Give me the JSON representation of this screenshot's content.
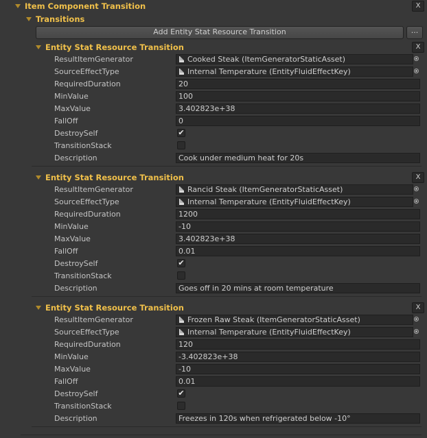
{
  "component": {
    "title": "Item Component Transition",
    "close_label": "X"
  },
  "transitions": {
    "title": "Transitions",
    "add_label": "Add Entity Stat Resource Transition",
    "more_label": "..."
  },
  "labels": {
    "result": "ResultItemGenerator",
    "source": "SourceEffectType",
    "duration": "RequiredDuration",
    "min": "MinValue",
    "max": "MaxValue",
    "falloff": "FallOff",
    "destroy": "DestroySelf",
    "stack": "TransitionStack",
    "desc": "Description"
  },
  "items": [
    {
      "title": "Entity Stat Resource Transition",
      "close_label": "X",
      "result": "Cooked Steak (ItemGeneratorStaticAsset)",
      "source": "Internal Temperature (EntityFluidEffectKey)",
      "duration": "20",
      "min": "100",
      "max": "3.402823e+38",
      "falloff": "0",
      "destroy_check": "✔",
      "stack_check": "",
      "desc": "Cook under medium heat for 20s"
    },
    {
      "title": "Entity Stat Resource Transition",
      "close_label": "X",
      "result": "Rancid Steak (ItemGeneratorStaticAsset)",
      "source": "Internal Temperature (EntityFluidEffectKey)",
      "duration": "1200",
      "min": "-10",
      "max": "3.402823e+38",
      "falloff": "0.01",
      "destroy_check": "✔",
      "stack_check": "",
      "desc": "Goes off in 20 mins at room temperature"
    },
    {
      "title": "Entity Stat Resource Transition",
      "close_label": "X",
      "result": "Frozen Raw Steak (ItemGeneratorStaticAsset)",
      "source": "Internal Temperature (EntityFluidEffectKey)",
      "duration": "120",
      "min": "-3.402823e+38",
      "max": "-10",
      "falloff": "0.01",
      "destroy_check": "✔",
      "stack_check": "",
      "desc": "Freezes in 120s when refrigerated below -10°"
    }
  ]
}
